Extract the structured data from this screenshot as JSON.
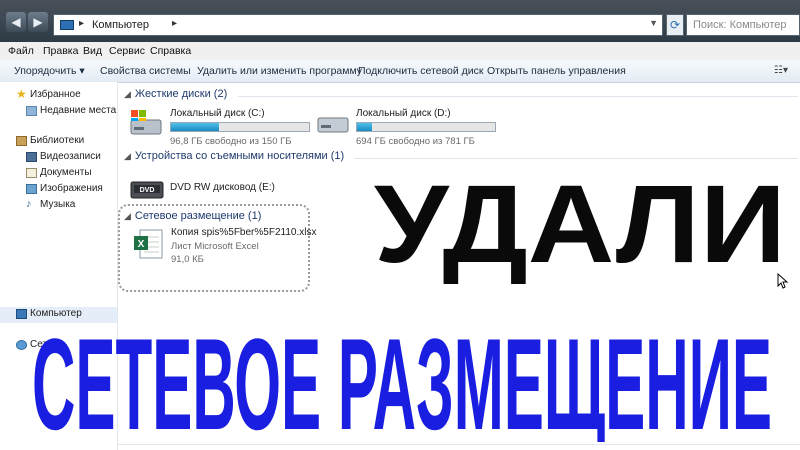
{
  "window": {
    "breadcrumb": "Компьютер",
    "search_placeholder": "Поиск: Компьютер"
  },
  "menu": [
    "Файл",
    "Правка",
    "Вид",
    "Сервис",
    "Справка"
  ],
  "toolbar": {
    "organize": "Упорядочить ▾",
    "system_properties": "Свойства системы",
    "uninstall": "Удалить или изменить программу",
    "map_drive": "Подключить сетевой диск",
    "control_panel": "Открыть панель управления"
  },
  "nav": {
    "favorites": "Избранное",
    "recent": "Недавние места",
    "libraries": "Библиотеки",
    "videos": "Видеозаписи",
    "documents": "Документы",
    "images": "Изображения",
    "music": "Музыка",
    "computer": "Компьютер",
    "network": "Сеть"
  },
  "groups": {
    "hard_drives": "Жесткие диски (2)",
    "removable": "Устройства со съемными носителями (1)",
    "network_location": "Сетевое размещение (1)"
  },
  "drives": [
    {
      "name": "Локальный диск (C:)",
      "free": "96,8 ГБ свободно из 150 ГБ",
      "used_fraction": 0.35
    },
    {
      "name": "Локальный диск (D:)",
      "free": "694 ГБ свободно из 781 ГБ",
      "used_fraction": 0.11
    }
  ],
  "dvd": {
    "name": "DVD RW дисковод (E:)",
    "badge": "DVD"
  },
  "network_file": {
    "name": "Копия spis%5Fber%5F2110.xlsx",
    "type": "Лист Microsoft Excel",
    "size": "91,0 КБ"
  },
  "overlay": {
    "line1": "УДАЛИ",
    "line2": "СЕТЕВОЕ РАЗМЕЩЕНИЕ"
  },
  "colors": {
    "overlay_line1": "#0a0a0a",
    "overlay_line2": "#1a1ee0",
    "drive_fill": "#2aa2d6",
    "group_header": "#1f3a6d"
  }
}
